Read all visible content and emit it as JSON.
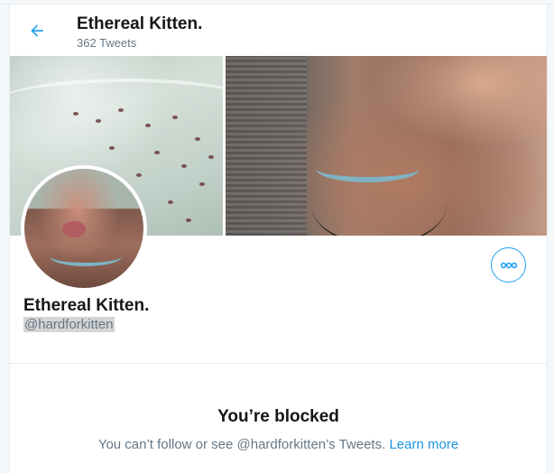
{
  "header": {
    "title": "Ethereal Kitten.",
    "tweet_count": "362 Tweets"
  },
  "profile": {
    "display_name": "Ethereal Kitten.",
    "handle": "@hardforkitten"
  },
  "blocked": {
    "title": "You’re blocked",
    "message": "You can’t follow or see @hardforkitten’s Tweets.",
    "link": "Learn more"
  },
  "icons": {
    "back": "arrow-left-icon",
    "more": "more-horizontal-icon"
  },
  "colors": {
    "accent": "#1da1f2",
    "link": "#1b95e0",
    "text_primary": "#14171a",
    "text_secondary": "#657786"
  }
}
